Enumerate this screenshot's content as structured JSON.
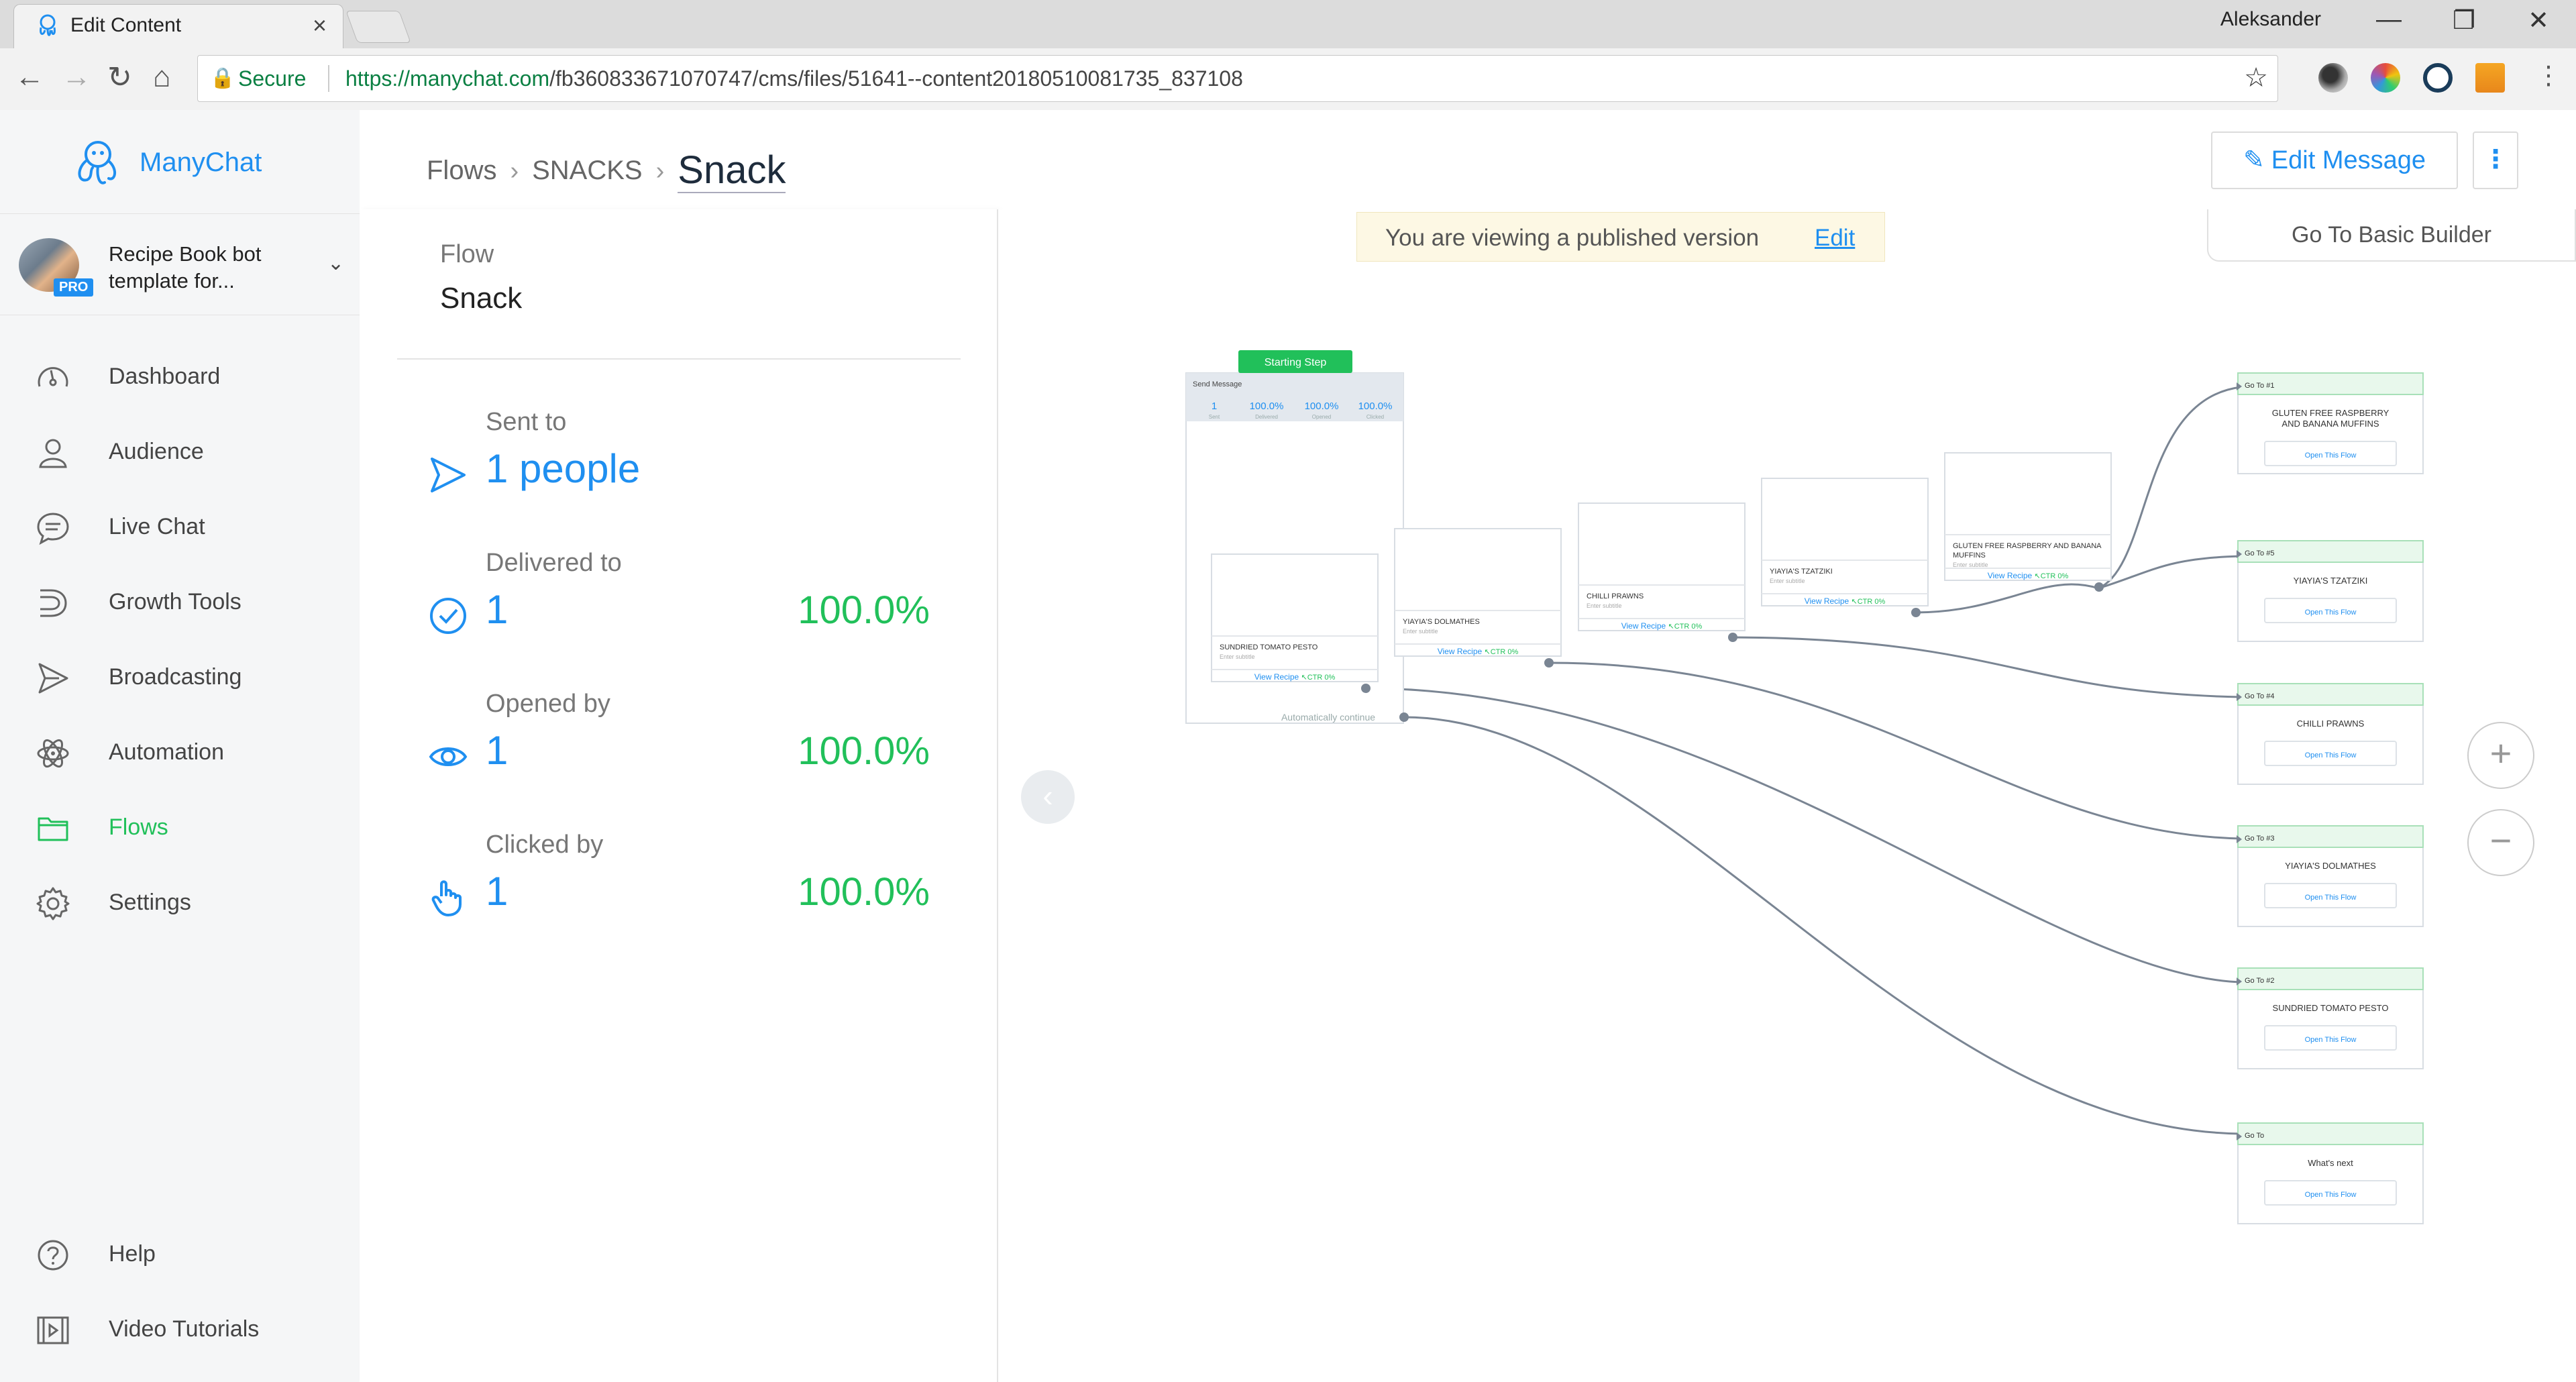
{
  "browser": {
    "tab_title": "Edit Content",
    "user_name": "Aleksander",
    "secure_label": "Secure",
    "url_host": "https://manychat.com",
    "url_path": "/fb360833671070747/cms/files/51641--content20180510081735_837108"
  },
  "sidebar": {
    "brand": "ManyChat",
    "account_name": "Recipe Book bot template for...",
    "account_badge": "PRO",
    "items": [
      {
        "label": "Dashboard",
        "icon": "dashboard-icon"
      },
      {
        "label": "Audience",
        "icon": "user-icon"
      },
      {
        "label": "Live Chat",
        "icon": "chat-icon"
      },
      {
        "label": "Growth Tools",
        "icon": "growth-tools-icon"
      },
      {
        "label": "Broadcasting",
        "icon": "broadcast-icon"
      },
      {
        "label": "Automation",
        "icon": "automation-icon"
      },
      {
        "label": "Flows",
        "icon": "folder-icon",
        "active": true
      },
      {
        "label": "Settings",
        "icon": "gear-icon"
      }
    ],
    "bottom_items": [
      {
        "label": "Help",
        "icon": "help-icon"
      },
      {
        "label": "Video Tutorials",
        "icon": "video-icon"
      }
    ],
    "active_color": "#21c05a"
  },
  "header": {
    "breadcrumb": [
      "Flows",
      "SNACKS",
      "Snack"
    ],
    "edit_message": "Edit Message",
    "more": "⋮"
  },
  "panel": {
    "flow_label": "Flow",
    "flow_name": "Snack",
    "stats": [
      {
        "label": "Sent to",
        "value": "1 people",
        "percent": ""
      },
      {
        "label": "Delivered to",
        "value": "1",
        "percent": "100.0%"
      },
      {
        "label": "Opened by",
        "value": "1",
        "percent": "100.0%"
      },
      {
        "label": "Clicked by",
        "value": "1",
        "percent": "100.0%"
      }
    ]
  },
  "canvas": {
    "banner_text": "You are viewing a published version",
    "banner_edit": "Edit",
    "basic_builder": "Go To Basic Builder",
    "start_badge": "Starting Step",
    "send_message": "Send Message",
    "metrics": [
      {
        "value": "1",
        "label": "Sent"
      },
      {
        "value": "100.0%",
        "label": "Delivered"
      },
      {
        "value": "100.0%",
        "label": "Opened"
      },
      {
        "value": "100.0%",
        "label": "Clicked"
      }
    ],
    "auto_continue": "Automatically continue",
    "cards": [
      {
        "title": "SUNDRIED TOMATO PESTO",
        "subtitle": "Enter subtitle",
        "button": "View Recipe",
        "ctr": "CTR 0%"
      },
      {
        "title": "YIAYIA'S DOLMATHES",
        "subtitle": "Enter subtitle",
        "button": "View Recipe",
        "ctr": "CTR 0%"
      },
      {
        "title": "CHILLI PRAWNS",
        "subtitle": "Enter subtitle",
        "button": "View Recipe",
        "ctr": "CTR 0%"
      },
      {
        "title": "YIAYIA'S TZATZIKI",
        "subtitle": "Enter subtitle",
        "button": "View Recipe",
        "ctr": "CTR 0%"
      },
      {
        "title": "GLUTEN FREE RASPBERRY AND BANANA MUFFINS",
        "subtitle": "Enter subtitle",
        "button": "View Recipe",
        "ctr": "CTR 0%"
      }
    ],
    "goto_nodes": [
      {
        "header": "Go To #1",
        "title": "GLUTEN FREE RASPBERRY AND BANANA MUFFINS",
        "button": "Open This Flow"
      },
      {
        "header": "Go To #5",
        "title": "YIAYIA'S TZATZIKI",
        "button": "Open This Flow"
      },
      {
        "header": "Go To #4",
        "title": "CHILLI PRAWNS",
        "button": "Open This Flow"
      },
      {
        "header": "Go To #3",
        "title": "YIAYIA'S DOLMATHES",
        "button": "Open This Flow"
      },
      {
        "header": "Go To #2",
        "title": "SUNDRIED TOMATO PESTO",
        "button": "Open This Flow"
      },
      {
        "header": "Go To",
        "title": "What's next",
        "button": "Open This Flow"
      }
    ],
    "zoom_in": "+",
    "zoom_out": "−",
    "collapse": "‹"
  }
}
